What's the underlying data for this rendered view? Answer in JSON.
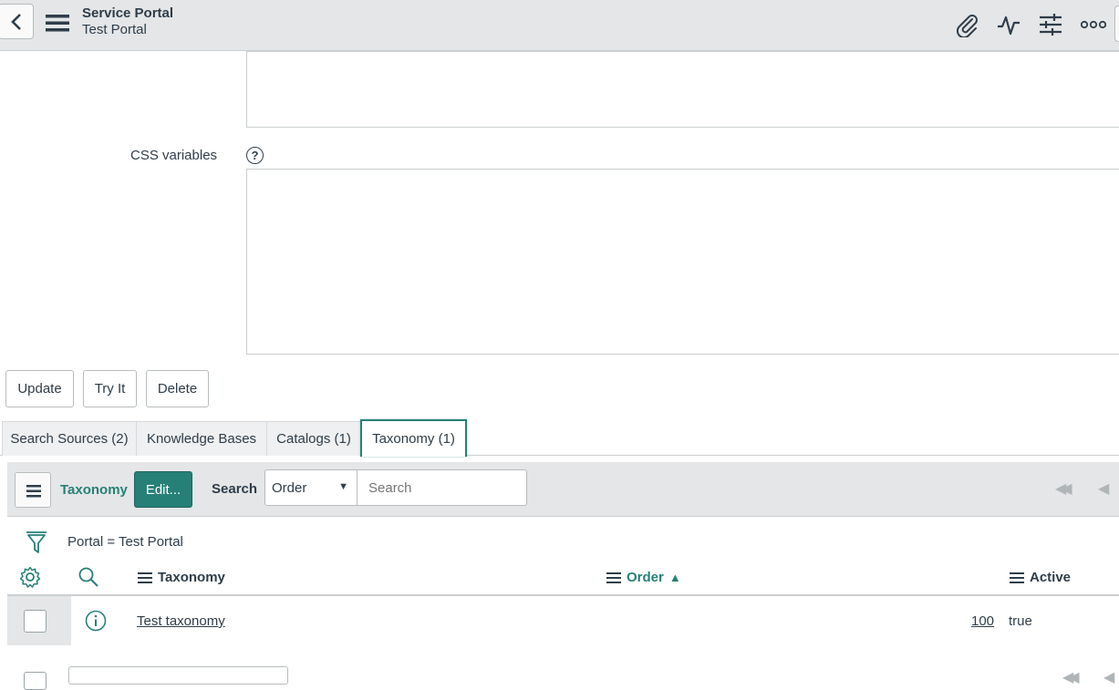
{
  "header": {
    "title": "Service Portal",
    "subtitle": "Test Portal",
    "icons": [
      "back-icon",
      "menu-icon",
      "paperclip-icon",
      "activity-icon",
      "settings-sliders-icon",
      "more-icon"
    ]
  },
  "form": {
    "css_variables_label": "CSS variables",
    "help_symbol": "?",
    "buttons": {
      "update": "Update",
      "try_it": "Try It",
      "delete": "Delete"
    }
  },
  "tabs": [
    {
      "label": "Search Sources (2)",
      "active": false
    },
    {
      "label": "Knowledge Bases",
      "active": false
    },
    {
      "label": "Catalogs (1)",
      "active": false
    },
    {
      "label": "Taxonomy (1)",
      "active": true
    }
  ],
  "list": {
    "title": "Taxonomy",
    "edit_label": "Edit...",
    "search_label": "Search",
    "search_field_selected": "Order",
    "search_placeholder": "Search",
    "filter_text": "Portal = Test Portal",
    "columns": [
      {
        "label": "Taxonomy",
        "sorted": false
      },
      {
        "label": "Order",
        "sorted": true,
        "sort_direction": "ascending"
      },
      {
        "label": "Active",
        "sorted": false
      }
    ],
    "rows": [
      {
        "taxonomy": "Test taxonomy",
        "order": "100",
        "active": "true"
      }
    ]
  },
  "colors": {
    "accent": "#278078",
    "header_bg": "#e4e6e7",
    "text": "#2e3d49"
  }
}
